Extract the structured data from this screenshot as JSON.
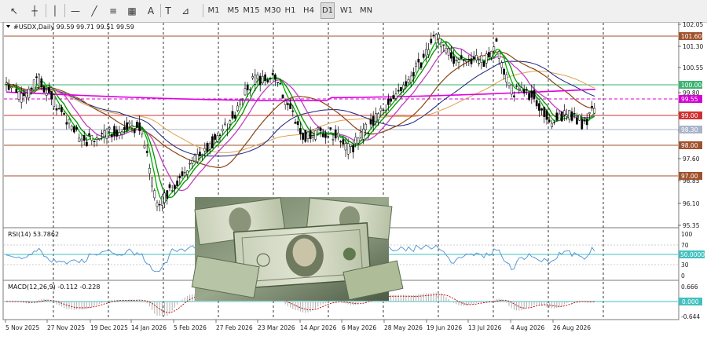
{
  "toolbar": {
    "tools": [
      {
        "name": "cursor-icon",
        "glyph": "↖"
      },
      {
        "name": "crosshair-icon",
        "glyph": "┼"
      },
      {
        "name": "vertical-line-icon",
        "glyph": "│"
      },
      {
        "name": "horizontal-line-icon",
        "glyph": "—"
      },
      {
        "name": "trendline-icon",
        "glyph": "╱"
      },
      {
        "name": "fibonacci-icon",
        "glyph": "≡"
      },
      {
        "name": "channel-icon",
        "glyph": "▦"
      },
      {
        "name": "text-icon",
        "glyph": "A"
      },
      {
        "name": "text-label-icon",
        "glyph": "T"
      },
      {
        "name": "shapes-icon",
        "glyph": "⊿"
      }
    ],
    "timeframes": [
      "M1",
      "M5",
      "M15",
      "M30",
      "H1",
      "H4",
      "D1",
      "W1",
      "MN"
    ],
    "active_timeframe": "D1"
  },
  "main_chart": {
    "header": "#USDX,Daily  99.59 99.71 99.51 99.59",
    "price_ticks": [
      "102.05",
      "101.30",
      "100.55",
      "99.80",
      "99.05",
      "98.30",
      "97.60",
      "96.85",
      "96.10",
      "95.35"
    ],
    "level_tags": [
      {
        "label": "101.60",
        "color": "#a0522d"
      },
      {
        "label": "100.00",
        "color": "#3cb371"
      },
      {
        "label": "99.55",
        "color": "#d400d4"
      },
      {
        "label": "99.00",
        "color": "#d03030"
      },
      {
        "label": "98.30",
        "color": "#a9b4c8"
      },
      {
        "label": "98.00",
        "color": "#a0522d"
      },
      {
        "label": "97.00",
        "color": "#a0522d"
      }
    ]
  },
  "rsi": {
    "header": "RSI(14) 53.7862",
    "ticks": [
      "100",
      "70",
      "30",
      "0"
    ],
    "level_tag": "50.0000"
  },
  "macd": {
    "header": "MACD(12,26,9) -0.112 -0.228",
    "ticks": [
      "0.666",
      "-0.644"
    ],
    "level_tag": "0.000"
  },
  "time_axis": [
    "5 Nov 2025",
    "27 Nov 2025",
    "19 Dec 2025",
    "14 Jan 2026",
    "5 Feb 2026",
    "27 Feb 2026",
    "23 Mar 2026",
    "14 Apr 2026",
    "6 May 2026",
    "28 May 2026",
    "19 Jun 2026",
    "13 Jul 2026",
    "4 Aug 2026",
    "26 Aug 2026"
  ],
  "colors": {
    "bull_candle": "#ffffff",
    "bear_candle": "#000000",
    "ma_fast": "#00b000",
    "ma_mid": "#009000",
    "ma_slow": "#c040c0",
    "ma_brown": "#8b4513",
    "ma_pink": "#e000e0",
    "ma_navy": "#1a237e",
    "ma_tan": "#e0a050",
    "rsi_line": "#4a90d0",
    "macd_hist": "#b0b0b0",
    "macd_signal": "#c00000"
  }
}
